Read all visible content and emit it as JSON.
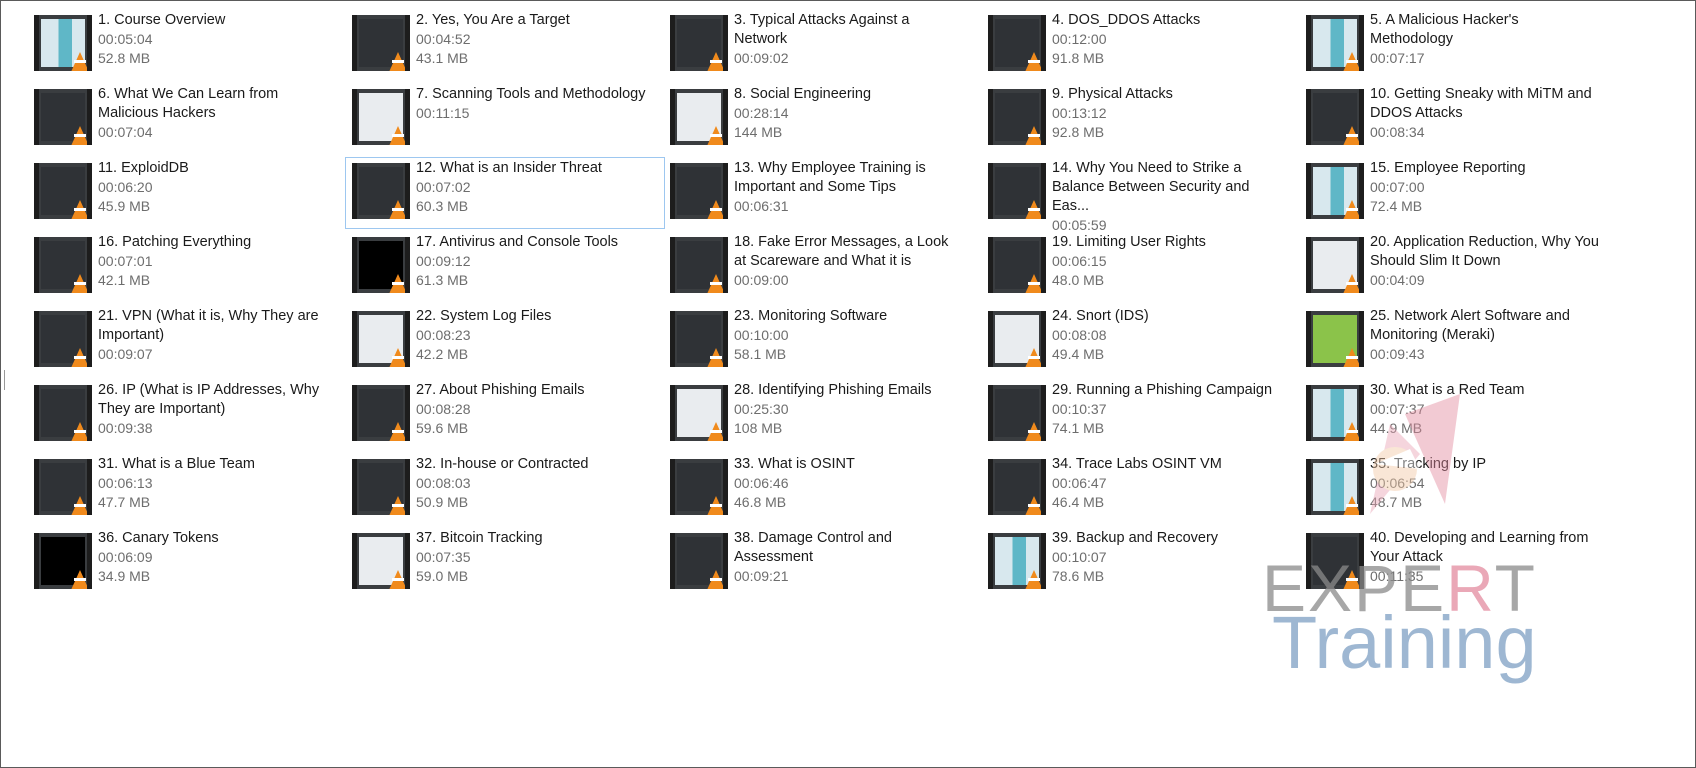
{
  "videos": [
    {
      "title": "1. Course Overview",
      "duration": "00:05:04",
      "size": "52.8 MB",
      "thumb": "teal"
    },
    {
      "title": "2. Yes, You Are a Target",
      "duration": "00:04:52",
      "size": "43.1 MB",
      "thumb": "dark"
    },
    {
      "title": "3. Typical Attacks Against a Network",
      "duration": "00:09:02",
      "size": "",
      "thumb": "dark"
    },
    {
      "title": "4. DOS_DDOS Attacks",
      "duration": "00:12:00",
      "size": "91.8 MB",
      "thumb": "dark"
    },
    {
      "title": "5. A Malicious Hacker's Methodology",
      "duration": "00:07:17",
      "size": "",
      "thumb": "teal"
    },
    {
      "title": "6. What We Can Learn from Malicious Hackers",
      "duration": "00:07:04",
      "size": "",
      "thumb": "dark"
    },
    {
      "title": "7. Scanning Tools and Methodology",
      "duration": "00:11:15",
      "size": "",
      "thumb": "light"
    },
    {
      "title": "8. Social Engineering",
      "duration": "00:28:14",
      "size": "144 MB",
      "thumb": "light"
    },
    {
      "title": "9. Physical Attacks",
      "duration": "00:13:12",
      "size": "92.8 MB",
      "thumb": "dark"
    },
    {
      "title": "10. Getting Sneaky with MiTM and DDOS Attacks",
      "duration": "00:08:34",
      "size": "",
      "thumb": "dark"
    },
    {
      "title": "11. ExploidDB",
      "duration": "00:06:20",
      "size": "45.9 MB",
      "thumb": "dark"
    },
    {
      "title": "12. What is an Insider Threat",
      "duration": "00:07:02",
      "size": "60.3 MB",
      "thumb": "dark",
      "selected": true
    },
    {
      "title": "13. Why Employee Training is Important and Some Tips",
      "duration": "00:06:31",
      "size": "",
      "thumb": "dark"
    },
    {
      "title": "14. Why You Need to Strike a Balance Between Security and Eas...",
      "duration": "00:05:59",
      "size": "",
      "thumb": "dark"
    },
    {
      "title": "15. Employee Reporting",
      "duration": "00:07:00",
      "size": "72.4 MB",
      "thumb": "teal"
    },
    {
      "title": "16. Patching Everything",
      "duration": "00:07:01",
      "size": "42.1 MB",
      "thumb": "dark"
    },
    {
      "title": "17. Antivirus and Console Tools",
      "duration": "00:09:12",
      "size": "61.3 MB",
      "thumb": "black"
    },
    {
      "title": "18. Fake Error Messages, a Look at Scareware and What it is",
      "duration": "00:09:00",
      "size": "",
      "thumb": "dark"
    },
    {
      "title": "19. Limiting User Rights",
      "duration": "00:06:15",
      "size": "48.0 MB",
      "thumb": "dark"
    },
    {
      "title": "20. Application Reduction, Why You Should Slim It Down",
      "duration": "00:04:09",
      "size": "",
      "thumb": "light"
    },
    {
      "title": "21. VPN (What it is, Why They are Important)",
      "duration": "00:09:07",
      "size": "",
      "thumb": "dark"
    },
    {
      "title": "22. System Log Files",
      "duration": "00:08:23",
      "size": "42.2 MB",
      "thumb": "light"
    },
    {
      "title": "23. Monitoring Software",
      "duration": "00:10:00",
      "size": "58.1 MB",
      "thumb": "dark"
    },
    {
      "title": "24. Snort (IDS)",
      "duration": "00:08:08",
      "size": "49.4 MB",
      "thumb": "light"
    },
    {
      "title": "25. Network Alert Software and Monitoring (Meraki)",
      "duration": "00:09:43",
      "size": "",
      "thumb": "green"
    },
    {
      "title": "26. IP (What is IP Addresses, Why They are Important)",
      "duration": "00:09:38",
      "size": "",
      "thumb": "dark"
    },
    {
      "title": "27. About Phishing Emails",
      "duration": "00:08:28",
      "size": "59.6 MB",
      "thumb": "dark"
    },
    {
      "title": "28. Identifying Phishing Emails",
      "duration": "00:25:30",
      "size": "108 MB",
      "thumb": "light"
    },
    {
      "title": "29. Running a Phishing Campaign",
      "duration": "00:10:37",
      "size": "74.1 MB",
      "thumb": "dark"
    },
    {
      "title": "30. What is a Red Team",
      "duration": "00:07:37",
      "size": "44.9 MB",
      "thumb": "teal"
    },
    {
      "title": "31. What is a Blue Team",
      "duration": "00:06:13",
      "size": "47.7 MB",
      "thumb": "dark"
    },
    {
      "title": "32. In-house or Contracted",
      "duration": "00:08:03",
      "size": "50.9 MB",
      "thumb": "dark"
    },
    {
      "title": "33. What is OSINT",
      "duration": "00:06:46",
      "size": "46.8 MB",
      "thumb": "dark"
    },
    {
      "title": "34. Trace Labs OSINT VM",
      "duration": "00:06:47",
      "size": "46.4 MB",
      "thumb": "dark"
    },
    {
      "title": "35. Tracking by IP",
      "duration": "00:06:54",
      "size": "48.7 MB",
      "thumb": "teal"
    },
    {
      "title": "36. Canary Tokens",
      "duration": "00:06:09",
      "size": "34.9 MB",
      "thumb": "black"
    },
    {
      "title": "37. Bitcoin Tracking",
      "duration": "00:07:35",
      "size": "59.0 MB",
      "thumb": "light"
    },
    {
      "title": "38. Damage Control and Assessment",
      "duration": "00:09:21",
      "size": "",
      "thumb": "dark"
    },
    {
      "title": "39. Backup and Recovery",
      "duration": "00:10:07",
      "size": "78.6 MB",
      "thumb": "teal"
    },
    {
      "title": "40. Developing and Learning from Your Attack",
      "duration": "00:11:35",
      "size": "",
      "thumb": "dark"
    }
  ],
  "watermark": {
    "line1_a": "EXPE",
    "line1_r": "R",
    "line1_b": "T",
    "line2": "Training"
  },
  "colors": {
    "selection_border": "#9dc7f0",
    "cone": "#f08a1c"
  }
}
